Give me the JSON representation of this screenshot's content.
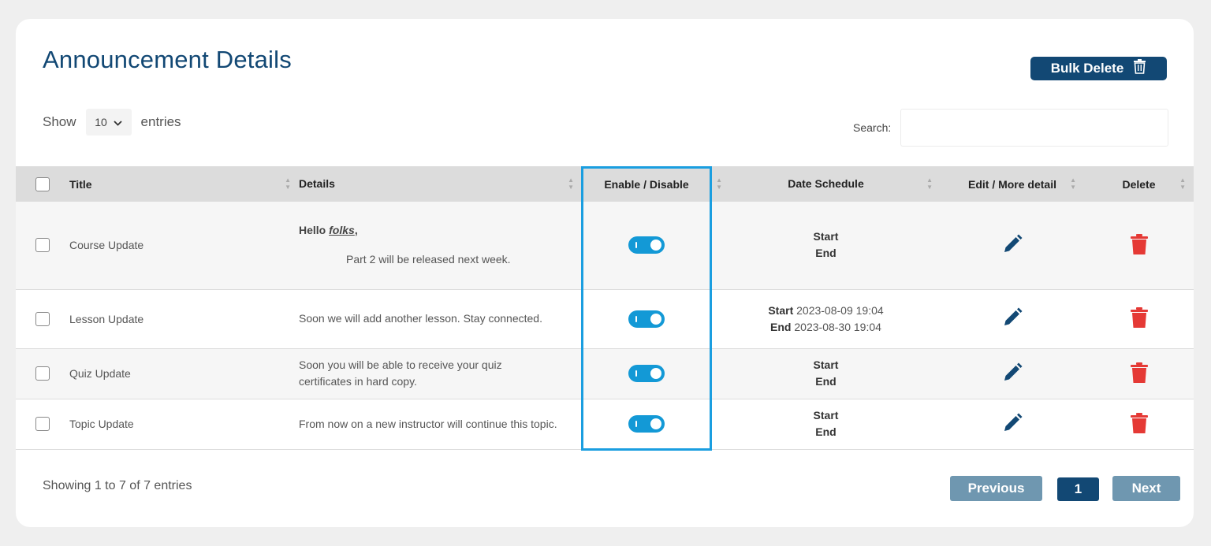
{
  "header": {
    "title": "Announcement Details",
    "bulk_delete_label": "Bulk Delete"
  },
  "controls": {
    "show_label": "Show",
    "entries_value": "10",
    "entries_label": "entries",
    "search_label": "Search:",
    "search_value": ""
  },
  "table": {
    "columns": [
      "Title",
      "Details",
      "Enable / Disable",
      "Date Schedule",
      "Edit / More detail",
      "Delete"
    ],
    "rows": [
      {
        "title": "Course Update",
        "details_line1_prefix": "Hello ",
        "details_line1_emph": "folks",
        "details_line1_suffix": ",",
        "details_line2": "Part 2 will be released next week.",
        "enabled": true,
        "start_label": "Start",
        "start_value": "",
        "end_label": "End",
        "end_value": ""
      },
      {
        "title": "Lesson Update",
        "details": "Soon we will add another lesson. Stay connected.",
        "enabled": true,
        "start_label": "Start",
        "start_value": "2023-08-09 19:04",
        "end_label": "End",
        "end_value": "2023-08-30 19:04"
      },
      {
        "title": "Quiz Update",
        "details": "Soon you will be able to receive your quiz certificates in hard copy.",
        "enabled": true,
        "start_label": "Start",
        "start_value": "",
        "end_label": "End",
        "end_value": ""
      },
      {
        "title": "Topic Update",
        "details": "From now on a new instructor will continue this topic.",
        "enabled": true,
        "start_label": "Start",
        "start_value": "",
        "end_label": "End",
        "end_value": ""
      }
    ]
  },
  "footer": {
    "info": "Showing 1 to 7 of 7 entries",
    "prev_label": "Previous",
    "page_label": "1",
    "next_label": "Next"
  },
  "colors": {
    "brand": "#124874",
    "toggle": "#1399d6",
    "delete": "#e53935",
    "highlight": "#1a9ee0"
  },
  "icons": {
    "edit": "pencil-icon",
    "delete": "trash-icon",
    "bulk_delete": "trash-icon"
  }
}
